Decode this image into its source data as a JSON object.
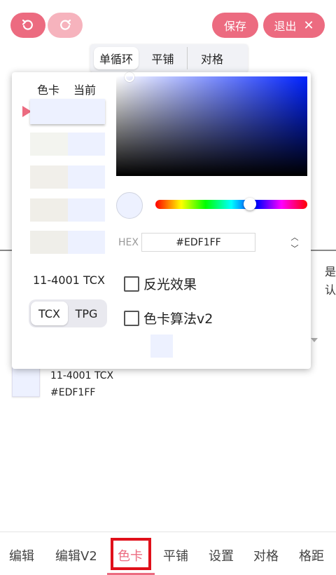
{
  "toolbar": {
    "undo_icon": "undo-icon",
    "redo_icon": "redo-icon",
    "save_label": "保存",
    "exit_label": "退出",
    "exit_icon": "close-icon",
    "accent_color": "#ec6b80"
  },
  "mode_tabs": [
    {
      "label": "单循环",
      "active": true
    },
    {
      "label": "平铺",
      "active": false
    },
    {
      "label": "对格",
      "active": false
    }
  ],
  "picker": {
    "header_card": "色卡",
    "header_current": "当前",
    "swatches": [
      {
        "card": "#edf1ff",
        "current": "#edf1ff",
        "selected": true
      },
      {
        "card": "#f3f4ef",
        "current": "#edf1ff",
        "selected": false
      },
      {
        "card": "#f1efea",
        "current": "#edf1ff",
        "selected": false
      },
      {
        "card": "#f0eee8",
        "current": "#edf1ff",
        "selected": false
      },
      {
        "card": "#efeee9",
        "current": "#edf1ff",
        "selected": false
      }
    ],
    "color_code": "11-4001 TCX",
    "systems": [
      {
        "label": "TCX",
        "active": true
      },
      {
        "label": "TPG",
        "active": false
      }
    ],
    "hex_label": "HEX",
    "hex_value": "#EDF1FF",
    "current_color": "#edf1ff",
    "reflect_label": "反光效果",
    "reflect_checked": false,
    "algo_label": "色卡算法v2",
    "algo_checked": false
  },
  "background": {
    "glyph_1": "是",
    "glyph_2": "认",
    "color_code": "11-4001 TCX",
    "hex": "#EDF1FF"
  },
  "bottom_nav": [
    {
      "label": "编辑",
      "active": false
    },
    {
      "label": "编辑V2",
      "active": false
    },
    {
      "label": "色卡",
      "active": true
    },
    {
      "label": "平铺",
      "active": false
    },
    {
      "label": "设置",
      "active": false
    },
    {
      "label": "对格",
      "active": false
    },
    {
      "label": "格距",
      "active": false
    }
  ]
}
